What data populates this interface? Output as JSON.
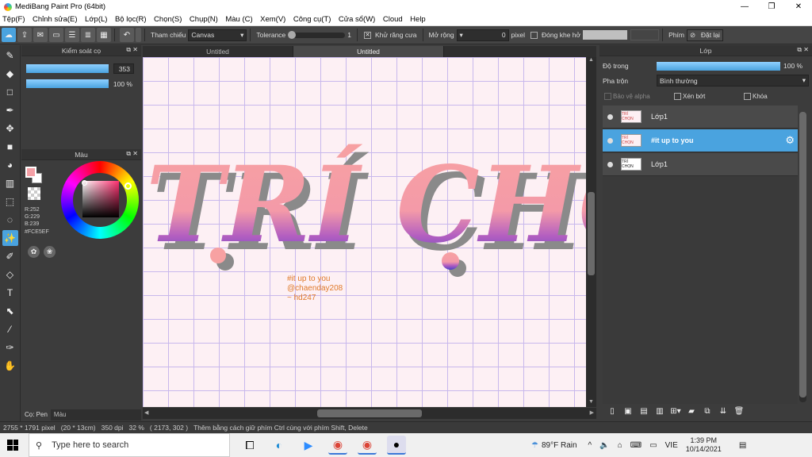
{
  "window": {
    "title": "MediBang Paint Pro (64bit)",
    "min": "—",
    "max": "❐",
    "close": "✕"
  },
  "menu": [
    "Tệp(F)",
    "Chỉnh sửa(E)",
    "Lớp(L)",
    "Bộ lọc(R)",
    "Chọn(S)",
    "Chụp(N)",
    "Màu (C)",
    "Xem(V)",
    "Công cụ(T)",
    "Cửa sổ(W)",
    "Cloud",
    "Help"
  ],
  "toolbar": {
    "reference_label": "Tham chiếu",
    "reference_value": "Canvas",
    "tolerance_label": "Tolerance",
    "tolerance_value": "1",
    "antialias_label": "Khử răng cưa",
    "expand_label": "Mở rộng",
    "expand_value": "0",
    "expand_unit": "pixel",
    "close_gap_label": "Đóng khe hở",
    "keys_label": "Phím",
    "reset_label": "Đặt lại"
  },
  "brush_panel": {
    "title": "Kiểm soát cọ",
    "size_value": "353",
    "opacity_value": "100 %"
  },
  "color_panel": {
    "title": "Màu",
    "r": "R:252",
    "g": "G:229",
    "b": "B:239",
    "hex": "#FCE5EF",
    "primary_color": "#f4a0a6",
    "secondary_color": "#ffffff"
  },
  "bottom_tabs": {
    "pen": "Cọ: Pen",
    "color": "Màu"
  },
  "tabs": [
    "Untitled",
    "Untitled"
  ],
  "canvas": {
    "artwork_text": "TRÍ CHỌN",
    "caption_lines": [
      "#it up to you",
      "@chaenday208",
      "~ hd247"
    ]
  },
  "layers_panel": {
    "title": "Lớp",
    "opacity_label": "Độ trong",
    "opacity_value": "100 %",
    "opacity_fraction": 1.0,
    "blend_label": "Pha trộn",
    "blend_value": "Bình thường",
    "protect_alpha": "Bảo vệ alpha",
    "clipping": "Xén bớt",
    "lock": "Khóa",
    "layers": [
      {
        "name": "Lớp1",
        "thumb": "TRÍ CHỌN",
        "selected": false
      },
      {
        "name": "#it up to you",
        "thumb": "TRÍ CHỌN",
        "selected": true
      },
      {
        "name": "Lớp1",
        "thumb": "TRÍ CHỌN",
        "selected": false
      }
    ]
  },
  "status": {
    "size": "2755 * 1791 pixel",
    "cm": "(20 * 13cm)",
    "dpi": "350 dpi",
    "zoom": "32 %",
    "coords": "( 2173, 302 )",
    "hint": "Thêm bằng cách giữ phím Ctrl cùng với phím Shift, Delete"
  },
  "taskbar": {
    "search_placeholder": "Type here to search",
    "weather": "89°F Rain",
    "lang": "VIE",
    "time": "1:39 PM",
    "date": "10/14/2021"
  }
}
